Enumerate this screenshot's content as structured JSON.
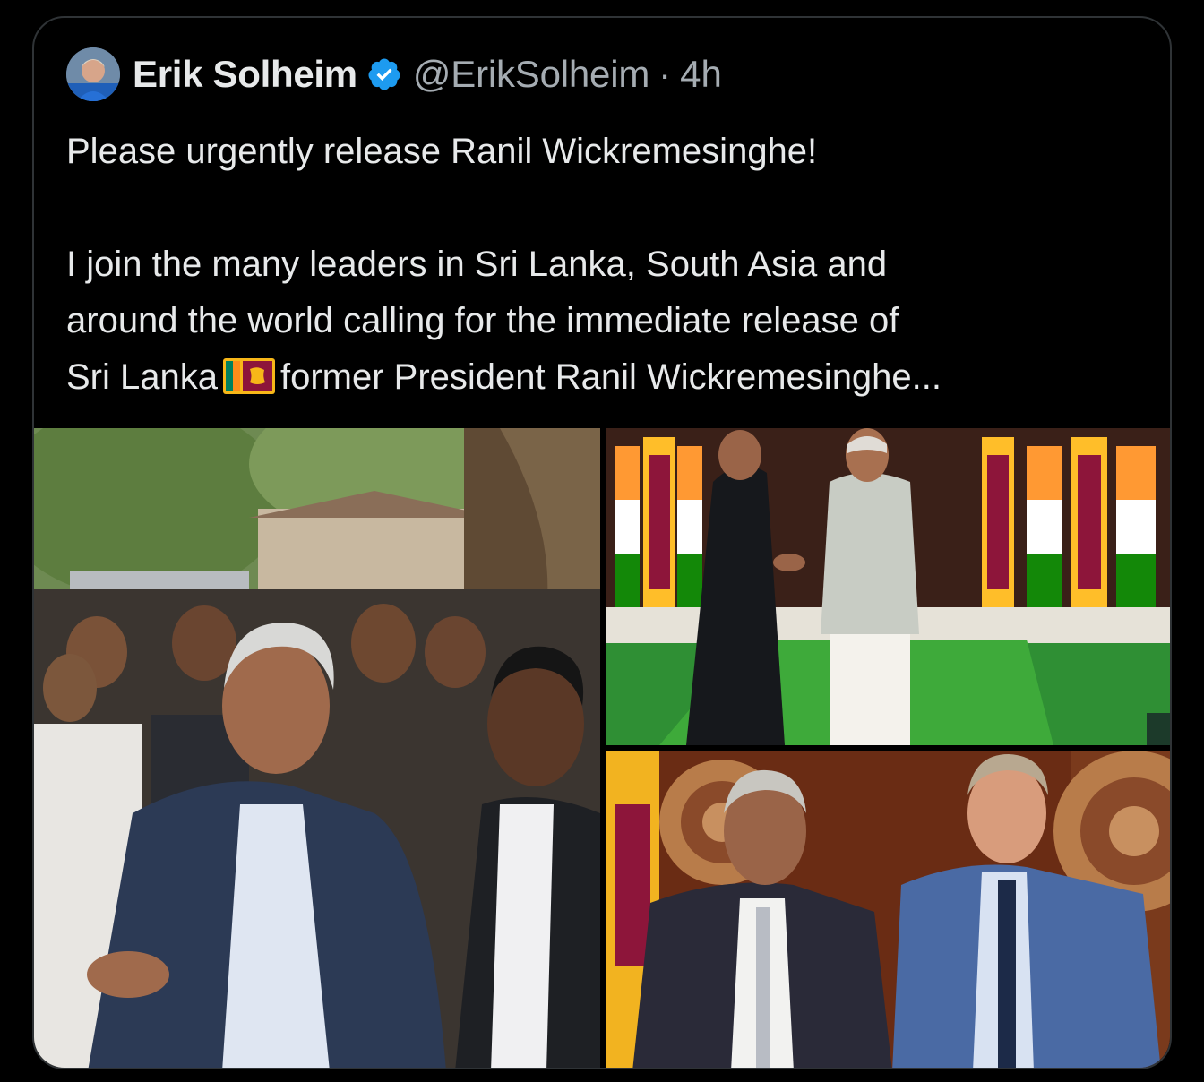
{
  "tweet": {
    "author_name": "Erik Solheim",
    "handle": "@ErikSolheim",
    "separator": "·",
    "time": "4h",
    "line1": "Please urgently release Ranil Wickremesinghe!",
    "line2": "I join the many leaders in Sri Lanka, South Asia and",
    "line3": "around the world calling for the immediate release of",
    "line4a": "Sri Lanka",
    "line4b": "former President Ranil Wickremesinghe..."
  },
  "colors": {
    "background": "#000000",
    "text": "#e7e9ea",
    "secondary": "#a5acb2",
    "verified": "#1d9bf0",
    "border": "#2f3336"
  },
  "icons": {
    "verified": "verified-badge-icon",
    "flag": "sri-lanka-flag-emoji"
  }
}
